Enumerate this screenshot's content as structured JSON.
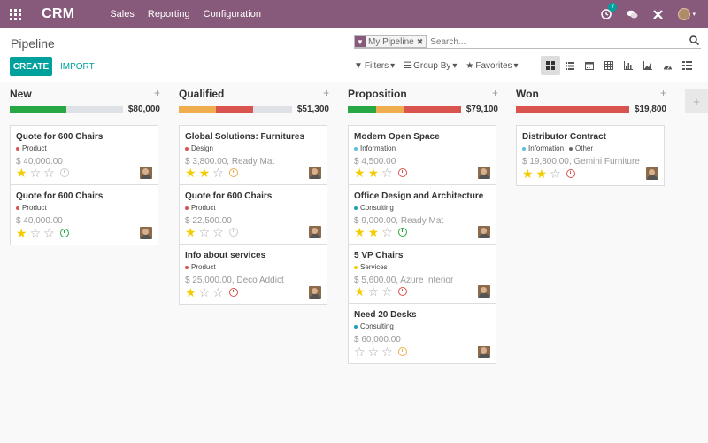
{
  "topbar": {
    "app_title": "CRM",
    "menu": [
      "Sales",
      "Reporting",
      "Configuration"
    ],
    "activity_count": "7"
  },
  "control_panel": {
    "title": "Pipeline",
    "create_label": "CREATE",
    "import_label": "IMPORT",
    "search": {
      "facet_label": "My Pipeline",
      "placeholder": "Search..."
    },
    "filters_label": "Filters",
    "groupby_label": "Group By",
    "favorites_label": "Favorites",
    "views": [
      "kanban-icon",
      "list-icon",
      "calendar-icon",
      "pivot-icon",
      "graph-icon",
      "cohort-icon",
      "dashboard-icon",
      "activity-icon"
    ]
  },
  "colors": {
    "brand": "#875a7b",
    "accent": "#00a09d",
    "won": "#28a745",
    "planned": "#f0ad4e",
    "overdue": "#d9534f",
    "star": "#f3cc00"
  },
  "columns": [
    {
      "name": "New",
      "total": "$80,000",
      "progress": [
        {
          "pct": 0.5,
          "color": "#28a745"
        }
      ],
      "cards": [
        {
          "title": "Quote for 600 Chairs",
          "tags": [
            {
              "label": "Product",
              "color": "#d9534f"
            }
          ],
          "amount": "$ 40,000.00",
          "stars": 1,
          "activity": "none"
        },
        {
          "title": "Quote for 600 Chairs",
          "tags": [
            {
              "label": "Product",
              "color": "#d9534f"
            }
          ],
          "amount": "$ 40,000.00",
          "stars": 1,
          "activity": "done"
        }
      ]
    },
    {
      "name": "Qualified",
      "total": "$51,300",
      "progress": [
        {
          "pct": 0.33,
          "color": "#f0ad4e"
        },
        {
          "pct": 0.33,
          "color": "#d9534f"
        }
      ],
      "cards": [
        {
          "title": "Global Solutions: Furnitures",
          "tags": [
            {
              "label": "Design",
              "color": "#d9534f"
            }
          ],
          "amount": "$ 3,800.00, Ready Mat",
          "stars": 2,
          "activity": "planned"
        },
        {
          "title": "Quote for 600 Chairs",
          "tags": [
            {
              "label": "Product",
              "color": "#d9534f"
            }
          ],
          "amount": "$ 22,500.00",
          "stars": 1,
          "activity": "none"
        },
        {
          "title": "Info about services",
          "tags": [
            {
              "label": "Product",
              "color": "#d9534f"
            }
          ],
          "amount": "$ 25,000.00, Deco Addict",
          "stars": 1,
          "activity": "overdue"
        }
      ]
    },
    {
      "name": "Proposition",
      "total": "$79,100",
      "progress": [
        {
          "pct": 0.25,
          "color": "#28a745"
        },
        {
          "pct": 0.25,
          "color": "#f0ad4e"
        },
        {
          "pct": 0.5,
          "color": "#d9534f"
        }
      ],
      "cards": [
        {
          "title": "Modern Open Space",
          "tags": [
            {
              "label": "Information",
              "color": "#5bc0de"
            }
          ],
          "amount": "$ 4,500.00",
          "stars": 2,
          "activity": "overdue"
        },
        {
          "title": "Office Design and Architecture",
          "tags": [
            {
              "label": "Consulting",
              "color": "#17a2b8"
            }
          ],
          "amount": "$ 9,000.00, Ready Mat",
          "stars": 2,
          "activity": "done"
        },
        {
          "title": "5 VP Chairs",
          "tags": [
            {
              "label": "Services",
              "color": "#f3cc00"
            }
          ],
          "amount": "$ 5,600.00, Azure Interior",
          "stars": 1,
          "activity": "overdue"
        },
        {
          "title": "Need 20 Desks",
          "tags": [
            {
              "label": "Consulting",
              "color": "#17a2b8"
            }
          ],
          "amount": "$ 60,000.00",
          "stars": 0,
          "activity": "planned"
        }
      ]
    },
    {
      "name": "Won",
      "total": "$19,800",
      "progress": [
        {
          "pct": 1.0,
          "color": "#d9534f"
        }
      ],
      "cards": [
        {
          "title": "Distributor Contract",
          "tags": [
            {
              "label": "Information",
              "color": "#5bc0de"
            },
            {
              "label": "Other",
              "color": "#666666"
            }
          ],
          "amount": "$ 19,800.00, Gemini Furniture",
          "stars": 2,
          "activity": "overdue"
        }
      ]
    }
  ]
}
